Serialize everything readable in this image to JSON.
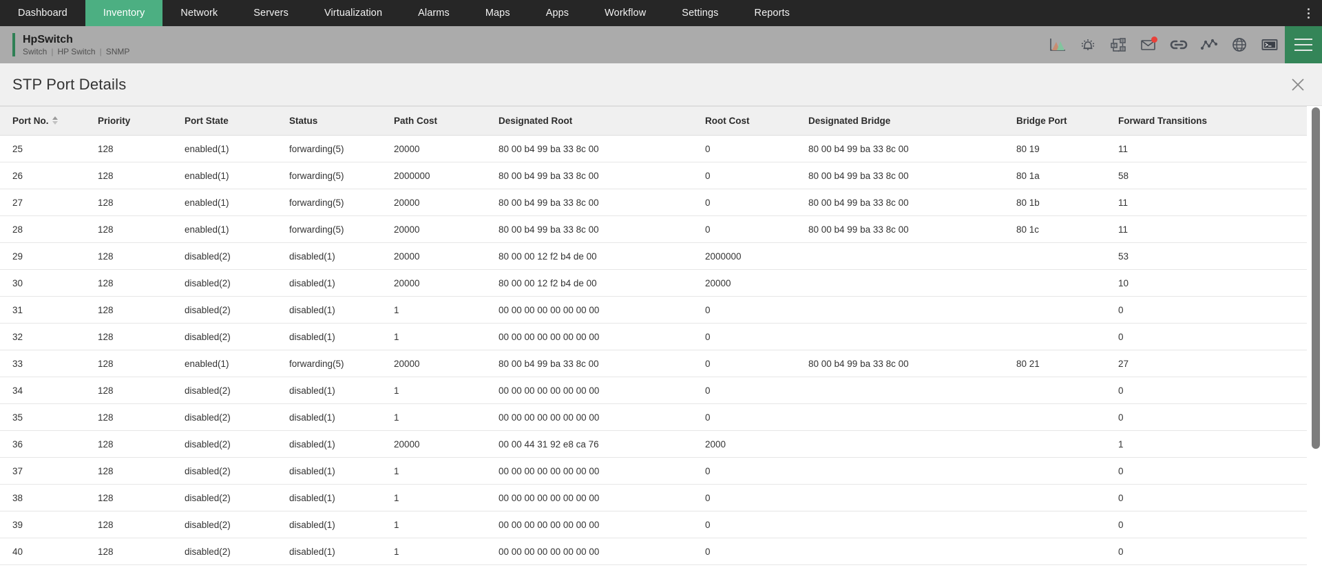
{
  "topnav": {
    "items": [
      {
        "label": "Dashboard",
        "active": false
      },
      {
        "label": "Inventory",
        "active": true
      },
      {
        "label": "Network",
        "active": false
      },
      {
        "label": "Servers",
        "active": false
      },
      {
        "label": "Virtualization",
        "active": false
      },
      {
        "label": "Alarms",
        "active": false
      },
      {
        "label": "Maps",
        "active": false
      },
      {
        "label": "Apps",
        "active": false
      },
      {
        "label": "Workflow",
        "active": false
      },
      {
        "label": "Settings",
        "active": false
      },
      {
        "label": "Reports",
        "active": false
      }
    ],
    "kebab_name": "overflow-menu-icon",
    "active_color": "#4caf82",
    "bg_color": "#262626"
  },
  "device_header": {
    "title": "HpSwitch",
    "subtitle_parts": [
      "Switch",
      "HP Switch",
      "SNMP"
    ],
    "subtitle": "Switch | HP Switch | SNMP",
    "accent_color": "#2f8055",
    "bg_color": "#ababab",
    "icons": [
      {
        "name": "performance-chart-icon"
      },
      {
        "name": "alarm-bell-icon"
      },
      {
        "name": "workflow-icon"
      },
      {
        "name": "mail-icon",
        "badge": true
      },
      {
        "name": "link-chain-icon"
      },
      {
        "name": "monitor-trend-icon"
      },
      {
        "name": "globe-icon"
      },
      {
        "name": "terminal-icon"
      }
    ],
    "hamburger_name": "main-menu-icon",
    "hamburger_color": "#348558"
  },
  "page": {
    "title": "STP Port Details",
    "close_label": "Close"
  },
  "table": {
    "sort_column": "Port No.",
    "sort_direction": "asc",
    "columns": [
      {
        "key": "port_no",
        "label": "Port No.",
        "cls": "c-port",
        "sortable": true
      },
      {
        "key": "priority",
        "label": "Priority",
        "cls": "c-prio"
      },
      {
        "key": "port_state",
        "label": "Port State",
        "cls": "c-state"
      },
      {
        "key": "status",
        "label": "Status",
        "cls": "c-stat"
      },
      {
        "key": "path_cost",
        "label": "Path Cost",
        "cls": "c-path"
      },
      {
        "key": "designated_root",
        "label": "Designated Root",
        "cls": "c-droot"
      },
      {
        "key": "root_cost",
        "label": "Root Cost",
        "cls": "c-rcost"
      },
      {
        "key": "designated_bridge",
        "label": "Designated Bridge",
        "cls": "c-dbr"
      },
      {
        "key": "bridge_port",
        "label": "Bridge Port",
        "cls": "c-bport"
      },
      {
        "key": "forward_transitions",
        "label": "Forward Transitions",
        "cls": "c-fwd"
      }
    ],
    "rows": [
      {
        "port_no": "25",
        "priority": "128",
        "port_state": "enabled(1)",
        "status": "forwarding(5)",
        "path_cost": "20000",
        "designated_root": "80 00 b4 99 ba 33 8c 00",
        "root_cost": "0",
        "designated_bridge": "80 00 b4 99 ba 33 8c 00",
        "bridge_port": "80 19",
        "forward_transitions": "11"
      },
      {
        "port_no": "26",
        "priority": "128",
        "port_state": "enabled(1)",
        "status": "forwarding(5)",
        "path_cost": "2000000",
        "designated_root": "80 00 b4 99 ba 33 8c 00",
        "root_cost": "0",
        "designated_bridge": "80 00 b4 99 ba 33 8c 00",
        "bridge_port": "80 1a",
        "forward_transitions": "58"
      },
      {
        "port_no": "27",
        "priority": "128",
        "port_state": "enabled(1)",
        "status": "forwarding(5)",
        "path_cost": "20000",
        "designated_root": "80 00 b4 99 ba 33 8c 00",
        "root_cost": "0",
        "designated_bridge": "80 00 b4 99 ba 33 8c 00",
        "bridge_port": "80 1b",
        "forward_transitions": "11"
      },
      {
        "port_no": "28",
        "priority": "128",
        "port_state": "enabled(1)",
        "status": "forwarding(5)",
        "path_cost": "20000",
        "designated_root": "80 00 b4 99 ba 33 8c 00",
        "root_cost": "0",
        "designated_bridge": "80 00 b4 99 ba 33 8c 00",
        "bridge_port": "80 1c",
        "forward_transitions": "11"
      },
      {
        "port_no": "29",
        "priority": "128",
        "port_state": "disabled(2)",
        "status": "disabled(1)",
        "path_cost": "20000",
        "designated_root": "80 00 00 12 f2 b4 de 00",
        "root_cost": "2000000",
        "designated_bridge": "",
        "bridge_port": "",
        "forward_transitions": "53"
      },
      {
        "port_no": "30",
        "priority": "128",
        "port_state": "disabled(2)",
        "status": "disabled(1)",
        "path_cost": "20000",
        "designated_root": "80 00 00 12 f2 b4 de 00",
        "root_cost": "20000",
        "designated_bridge": "",
        "bridge_port": "",
        "forward_transitions": "10"
      },
      {
        "port_no": "31",
        "priority": "128",
        "port_state": "disabled(2)",
        "status": "disabled(1)",
        "path_cost": "1",
        "designated_root": "00 00 00 00 00 00 00 00",
        "root_cost": "0",
        "designated_bridge": "",
        "bridge_port": "",
        "forward_transitions": "0"
      },
      {
        "port_no": "32",
        "priority": "128",
        "port_state": "disabled(2)",
        "status": "disabled(1)",
        "path_cost": "1",
        "designated_root": "00 00 00 00 00 00 00 00",
        "root_cost": "0",
        "designated_bridge": "",
        "bridge_port": "",
        "forward_transitions": "0"
      },
      {
        "port_no": "33",
        "priority": "128",
        "port_state": "enabled(1)",
        "status": "forwarding(5)",
        "path_cost": "20000",
        "designated_root": "80 00 b4 99 ba 33 8c 00",
        "root_cost": "0",
        "designated_bridge": "80 00 b4 99 ba 33 8c 00",
        "bridge_port": "80 21",
        "forward_transitions": "27"
      },
      {
        "port_no": "34",
        "priority": "128",
        "port_state": "disabled(2)",
        "status": "disabled(1)",
        "path_cost": "1",
        "designated_root": "00 00 00 00 00 00 00 00",
        "root_cost": "0",
        "designated_bridge": "",
        "bridge_port": "",
        "forward_transitions": "0"
      },
      {
        "port_no": "35",
        "priority": "128",
        "port_state": "disabled(2)",
        "status": "disabled(1)",
        "path_cost": "1",
        "designated_root": "00 00 00 00 00 00 00 00",
        "root_cost": "0",
        "designated_bridge": "",
        "bridge_port": "",
        "forward_transitions": "0"
      },
      {
        "port_no": "36",
        "priority": "128",
        "port_state": "disabled(2)",
        "status": "disabled(1)",
        "path_cost": "20000",
        "designated_root": "00 00 44 31 92 e8 ca 76",
        "root_cost": "2000",
        "designated_bridge": "",
        "bridge_port": "",
        "forward_transitions": "1"
      },
      {
        "port_no": "37",
        "priority": "128",
        "port_state": "disabled(2)",
        "status": "disabled(1)",
        "path_cost": "1",
        "designated_root": "00 00 00 00 00 00 00 00",
        "root_cost": "0",
        "designated_bridge": "",
        "bridge_port": "",
        "forward_transitions": "0"
      },
      {
        "port_no": "38",
        "priority": "128",
        "port_state": "disabled(2)",
        "status": "disabled(1)",
        "path_cost": "1",
        "designated_root": "00 00 00 00 00 00 00 00",
        "root_cost": "0",
        "designated_bridge": "",
        "bridge_port": "",
        "forward_transitions": "0"
      },
      {
        "port_no": "39",
        "priority": "128",
        "port_state": "disabled(2)",
        "status": "disabled(1)",
        "path_cost": "1",
        "designated_root": "00 00 00 00 00 00 00 00",
        "root_cost": "0",
        "designated_bridge": "",
        "bridge_port": "",
        "forward_transitions": "0"
      },
      {
        "port_no": "40",
        "priority": "128",
        "port_state": "disabled(2)",
        "status": "disabled(1)",
        "path_cost": "1",
        "designated_root": "00 00 00 00 00 00 00 00",
        "root_cost": "0",
        "designated_bridge": "",
        "bridge_port": "",
        "forward_transitions": "0"
      }
    ]
  }
}
